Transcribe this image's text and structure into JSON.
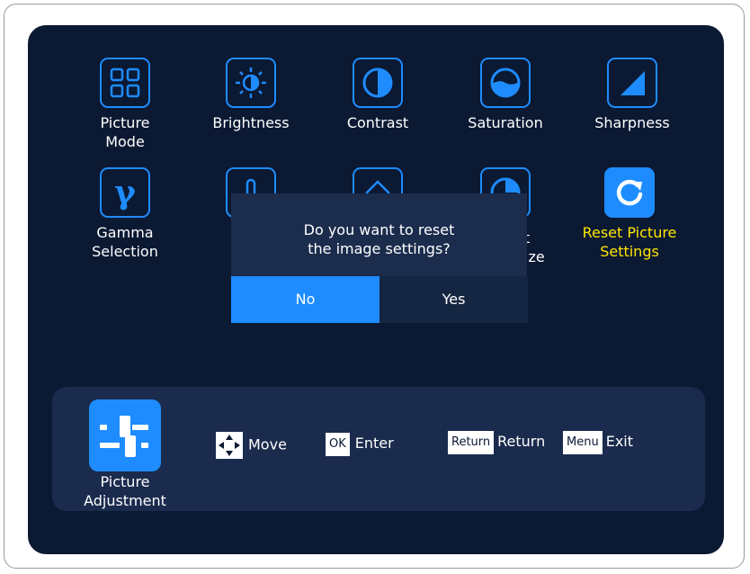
{
  "colors": {
    "accent": "#1e8cff",
    "background": "#0b1933",
    "highlight_text": "#ffe600"
  },
  "menu": {
    "tiles": [
      {
        "label": "Picture\nMode",
        "icon": "picture-mode-icon"
      },
      {
        "label": "Brightness",
        "icon": "brightness-icon"
      },
      {
        "label": "Contrast",
        "icon": "contrast-icon"
      },
      {
        "label": "Saturation",
        "icon": "saturation-icon"
      },
      {
        "label": "Sharpness",
        "icon": "sharpness-icon"
      },
      {
        "label": "Gamma\nSelection",
        "icon": "gamma-icon"
      },
      {
        "label": "",
        "icon": "color-temperature-icon"
      },
      {
        "label": "",
        "icon": "hue-icon"
      },
      {
        "label": "t\nize",
        "icon": "aspect-ratio-icon"
      },
      {
        "label": "Reset Picture\nSettings",
        "icon": "reset-icon",
        "selected": true
      }
    ]
  },
  "dialog": {
    "question_line1": "Do you want to reset",
    "question_line2": "the image settings?",
    "no_label": "No",
    "yes_label": "Yes"
  },
  "footer": {
    "section_label_line1": "Picture",
    "section_label_line2": "Adjustment",
    "move_label": "Move",
    "ok_key": "OK",
    "enter_label": "Enter",
    "return_key": "Return",
    "return_label": "Return",
    "menu_key": "Menu",
    "exit_label": "Exit"
  }
}
